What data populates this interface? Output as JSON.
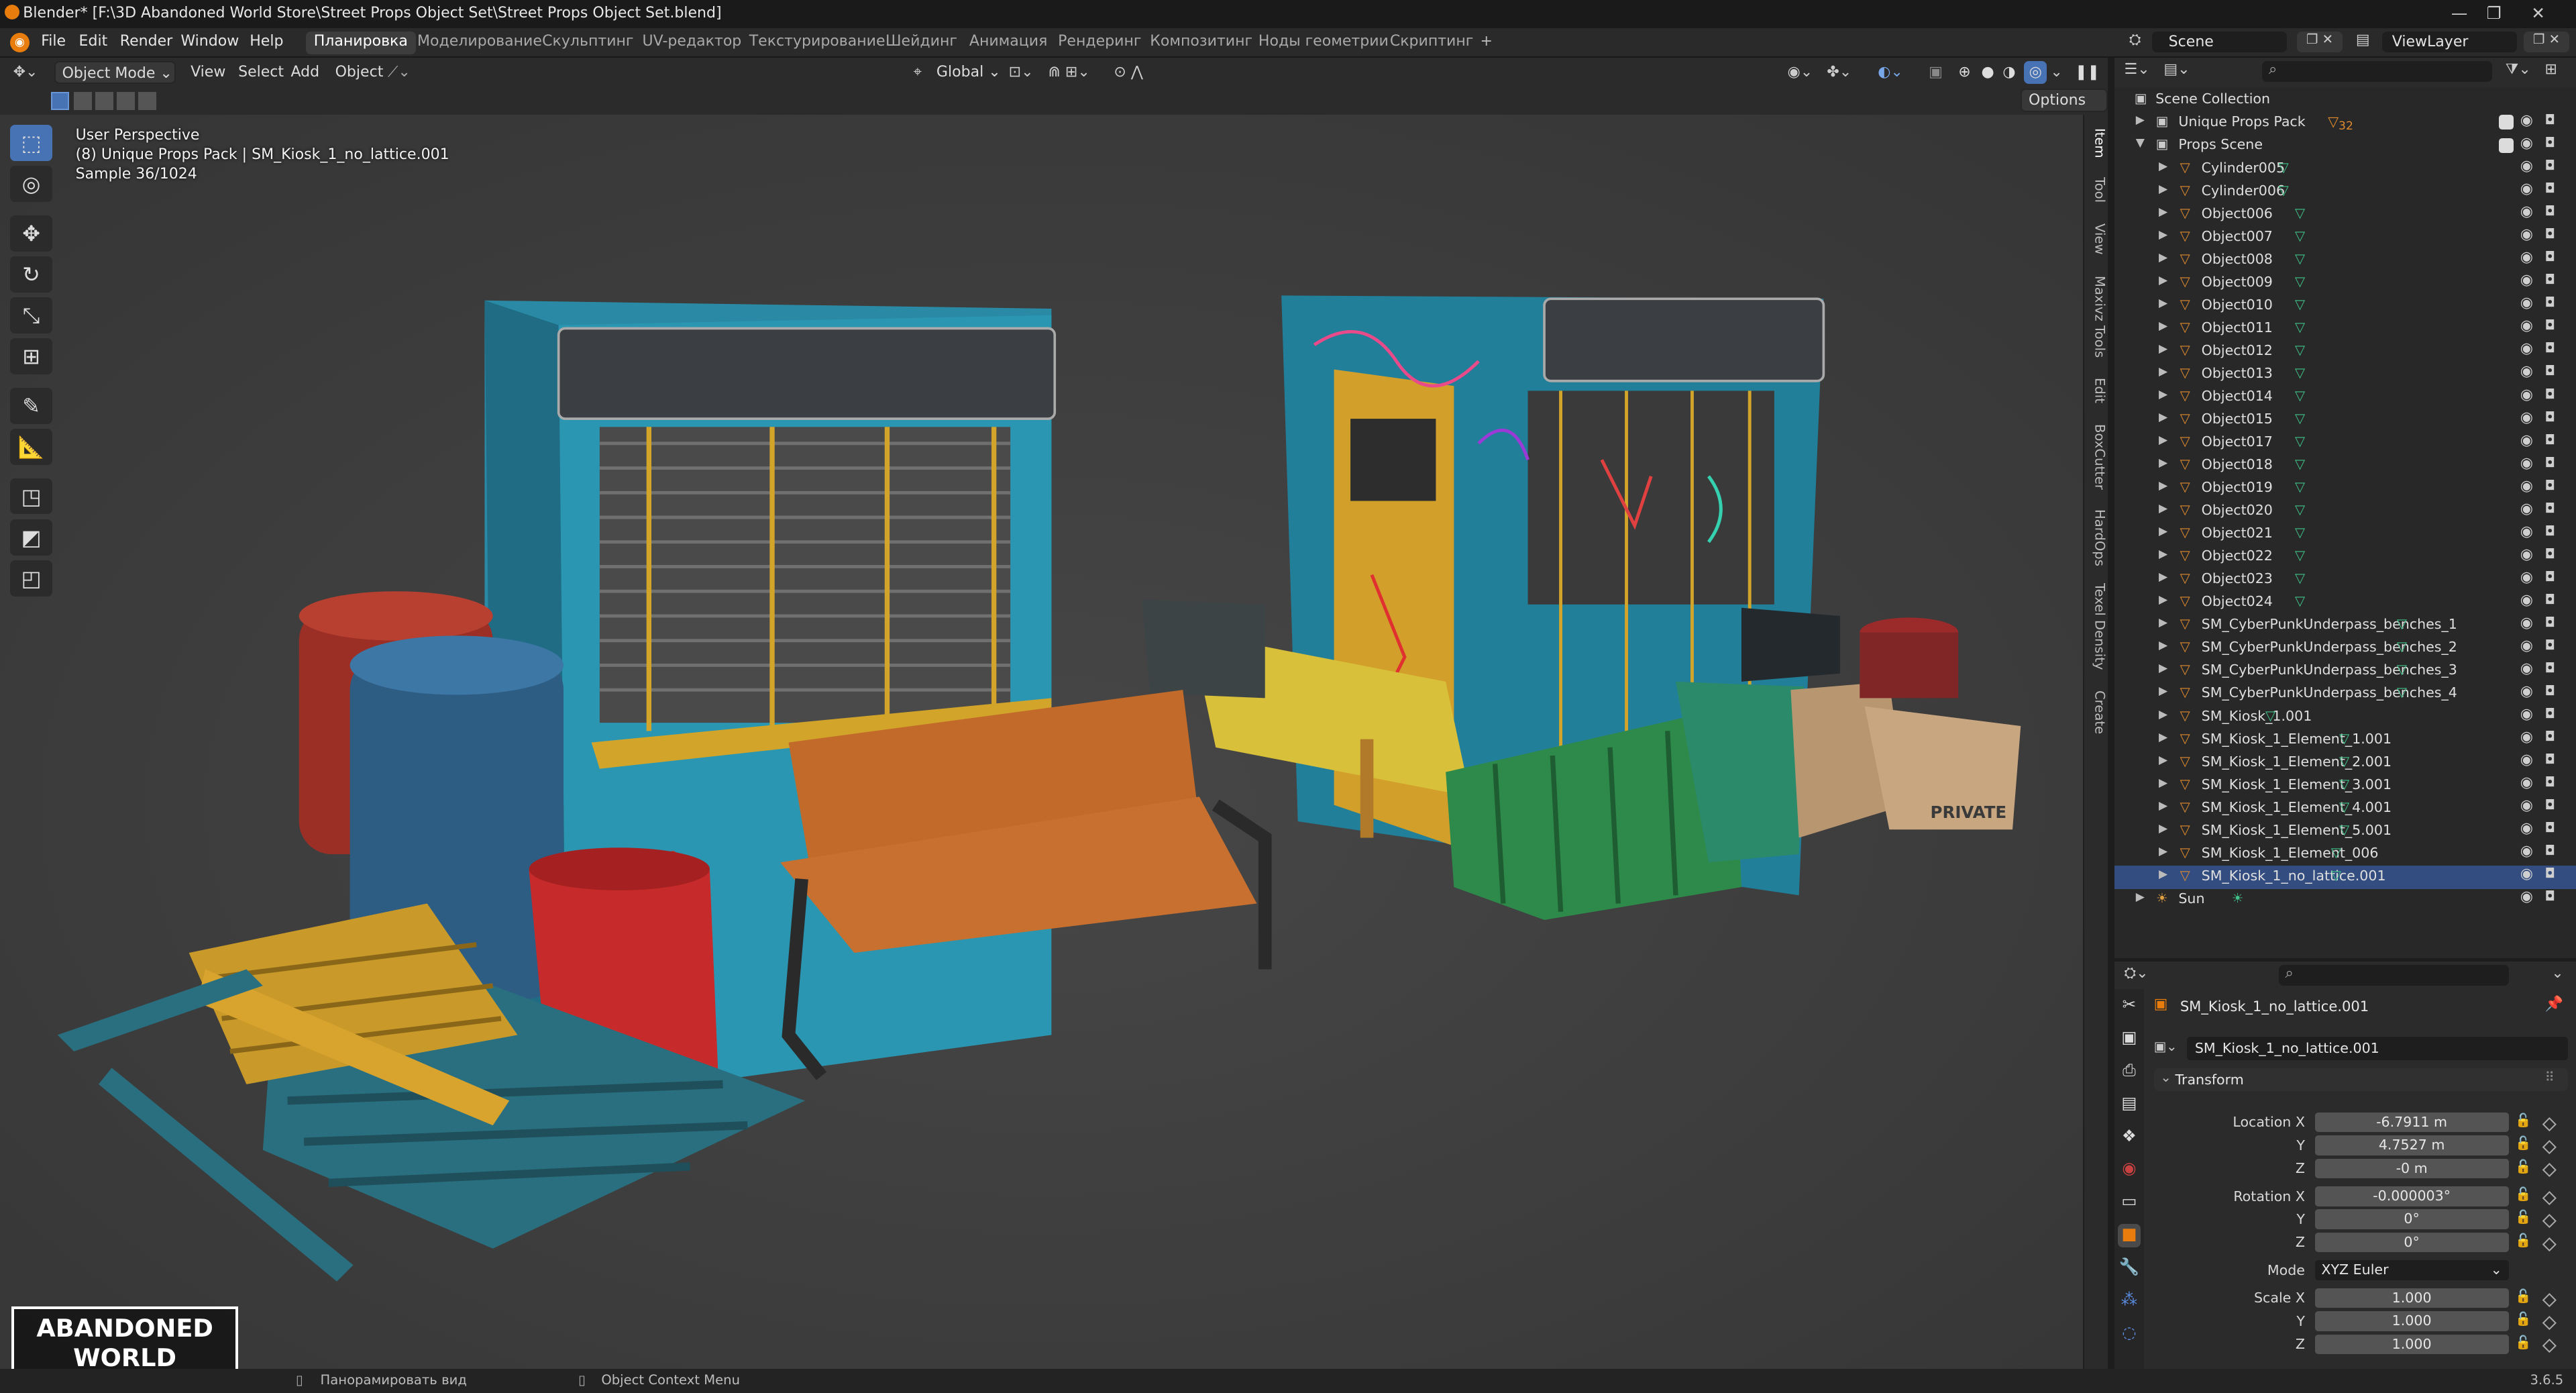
{
  "window": {
    "title": "Blender* [F:\\3D Abandoned World Store\\Street Props Object Set\\Street Props Object Set.blend]"
  },
  "menu": [
    "File",
    "Edit",
    "Render",
    "Window",
    "Help"
  ],
  "workspaces": [
    "Планировка",
    "Моделирование",
    "Скульптинг",
    "UV-редактор",
    "Текстурирование",
    "Шейдинг",
    "Анимация",
    "Рендеринг",
    "Композитинг",
    "Ноды геометрии",
    "Скриптинг"
  ],
  "active_workspace": "Планировка",
  "scene": {
    "name": "Scene",
    "view_layer": "ViewLayer"
  },
  "viewport_header": {
    "mode": "Object Mode",
    "view": "View",
    "select": "Select",
    "add": "Add",
    "object": "Object",
    "orientation": "Global",
    "options": "Options"
  },
  "overlay": {
    "perspective": "User Perspective",
    "object_info": "(8) Unique Props Pack | SM_Kiosk_1_no_lattice.001",
    "sample": "Sample 36/1024"
  },
  "n_panel_tabs": [
    "Item",
    "Tool",
    "View",
    "Maxivz Tools",
    "Edit",
    "BoxCutter",
    "HardOps",
    "Texel Density",
    "Create"
  ],
  "outliner": {
    "root": "Scene Collection",
    "collections": [
      {
        "name": "Unique Props Pack",
        "badge": "32"
      },
      {
        "name": "Props Scene"
      }
    ],
    "objects": [
      "Cylinder005",
      "Cylinder006",
      "Object006",
      "Object007",
      "Object008",
      "Object009",
      "Object010",
      "Object011",
      "Object012",
      "Object013",
      "Object014",
      "Object015",
      "Object017",
      "Object018",
      "Object019",
      "Object020",
      "Object021",
      "Object022",
      "Object023",
      "Object024",
      "SM_CyberPunkUnderpass_benches_1",
      "SM_CyberPunkUnderpass_benches_2",
      "SM_CyberPunkUnderpass_benches_3",
      "SM_CyberPunkUnderpass_benches_4",
      "SM_Kiosk_1.001",
      "SM_Kiosk_1_Element_1.001",
      "SM_Kiosk_1_Element_2.001",
      "SM_Kiosk_1_Element_3.001",
      "SM_Kiosk_1_Element_4.001",
      "SM_Kiosk_1_Element_5.001",
      "SM_Kiosk_1_Element_006",
      "SM_Kiosk_1_no_lattice.001"
    ],
    "light": "Sun"
  },
  "properties": {
    "object_name": "SM_Kiosk_1_no_lattice.001",
    "data_name": "SM_Kiosk_1_no_lattice.001",
    "panel": "Transform",
    "location_label": "Location X",
    "location": [
      "-6.7911 m",
      "4.7527 m",
      "-0 m"
    ],
    "rotation_label": "Rotation X",
    "rotation": [
      "-0.000003°",
      "0°",
      "0°"
    ],
    "mode_label": "Mode",
    "mode": "XYZ Euler",
    "scale_label": "Scale X",
    "scale": [
      "1.000",
      "1.000",
      "1.000"
    ],
    "axis_y": "Y",
    "axis_z": "Z"
  },
  "status": {
    "pan": "Панорамировать вид",
    "context": "Object Context Menu",
    "version": "3.6.5"
  },
  "logo": "ABANDONED WORLD"
}
